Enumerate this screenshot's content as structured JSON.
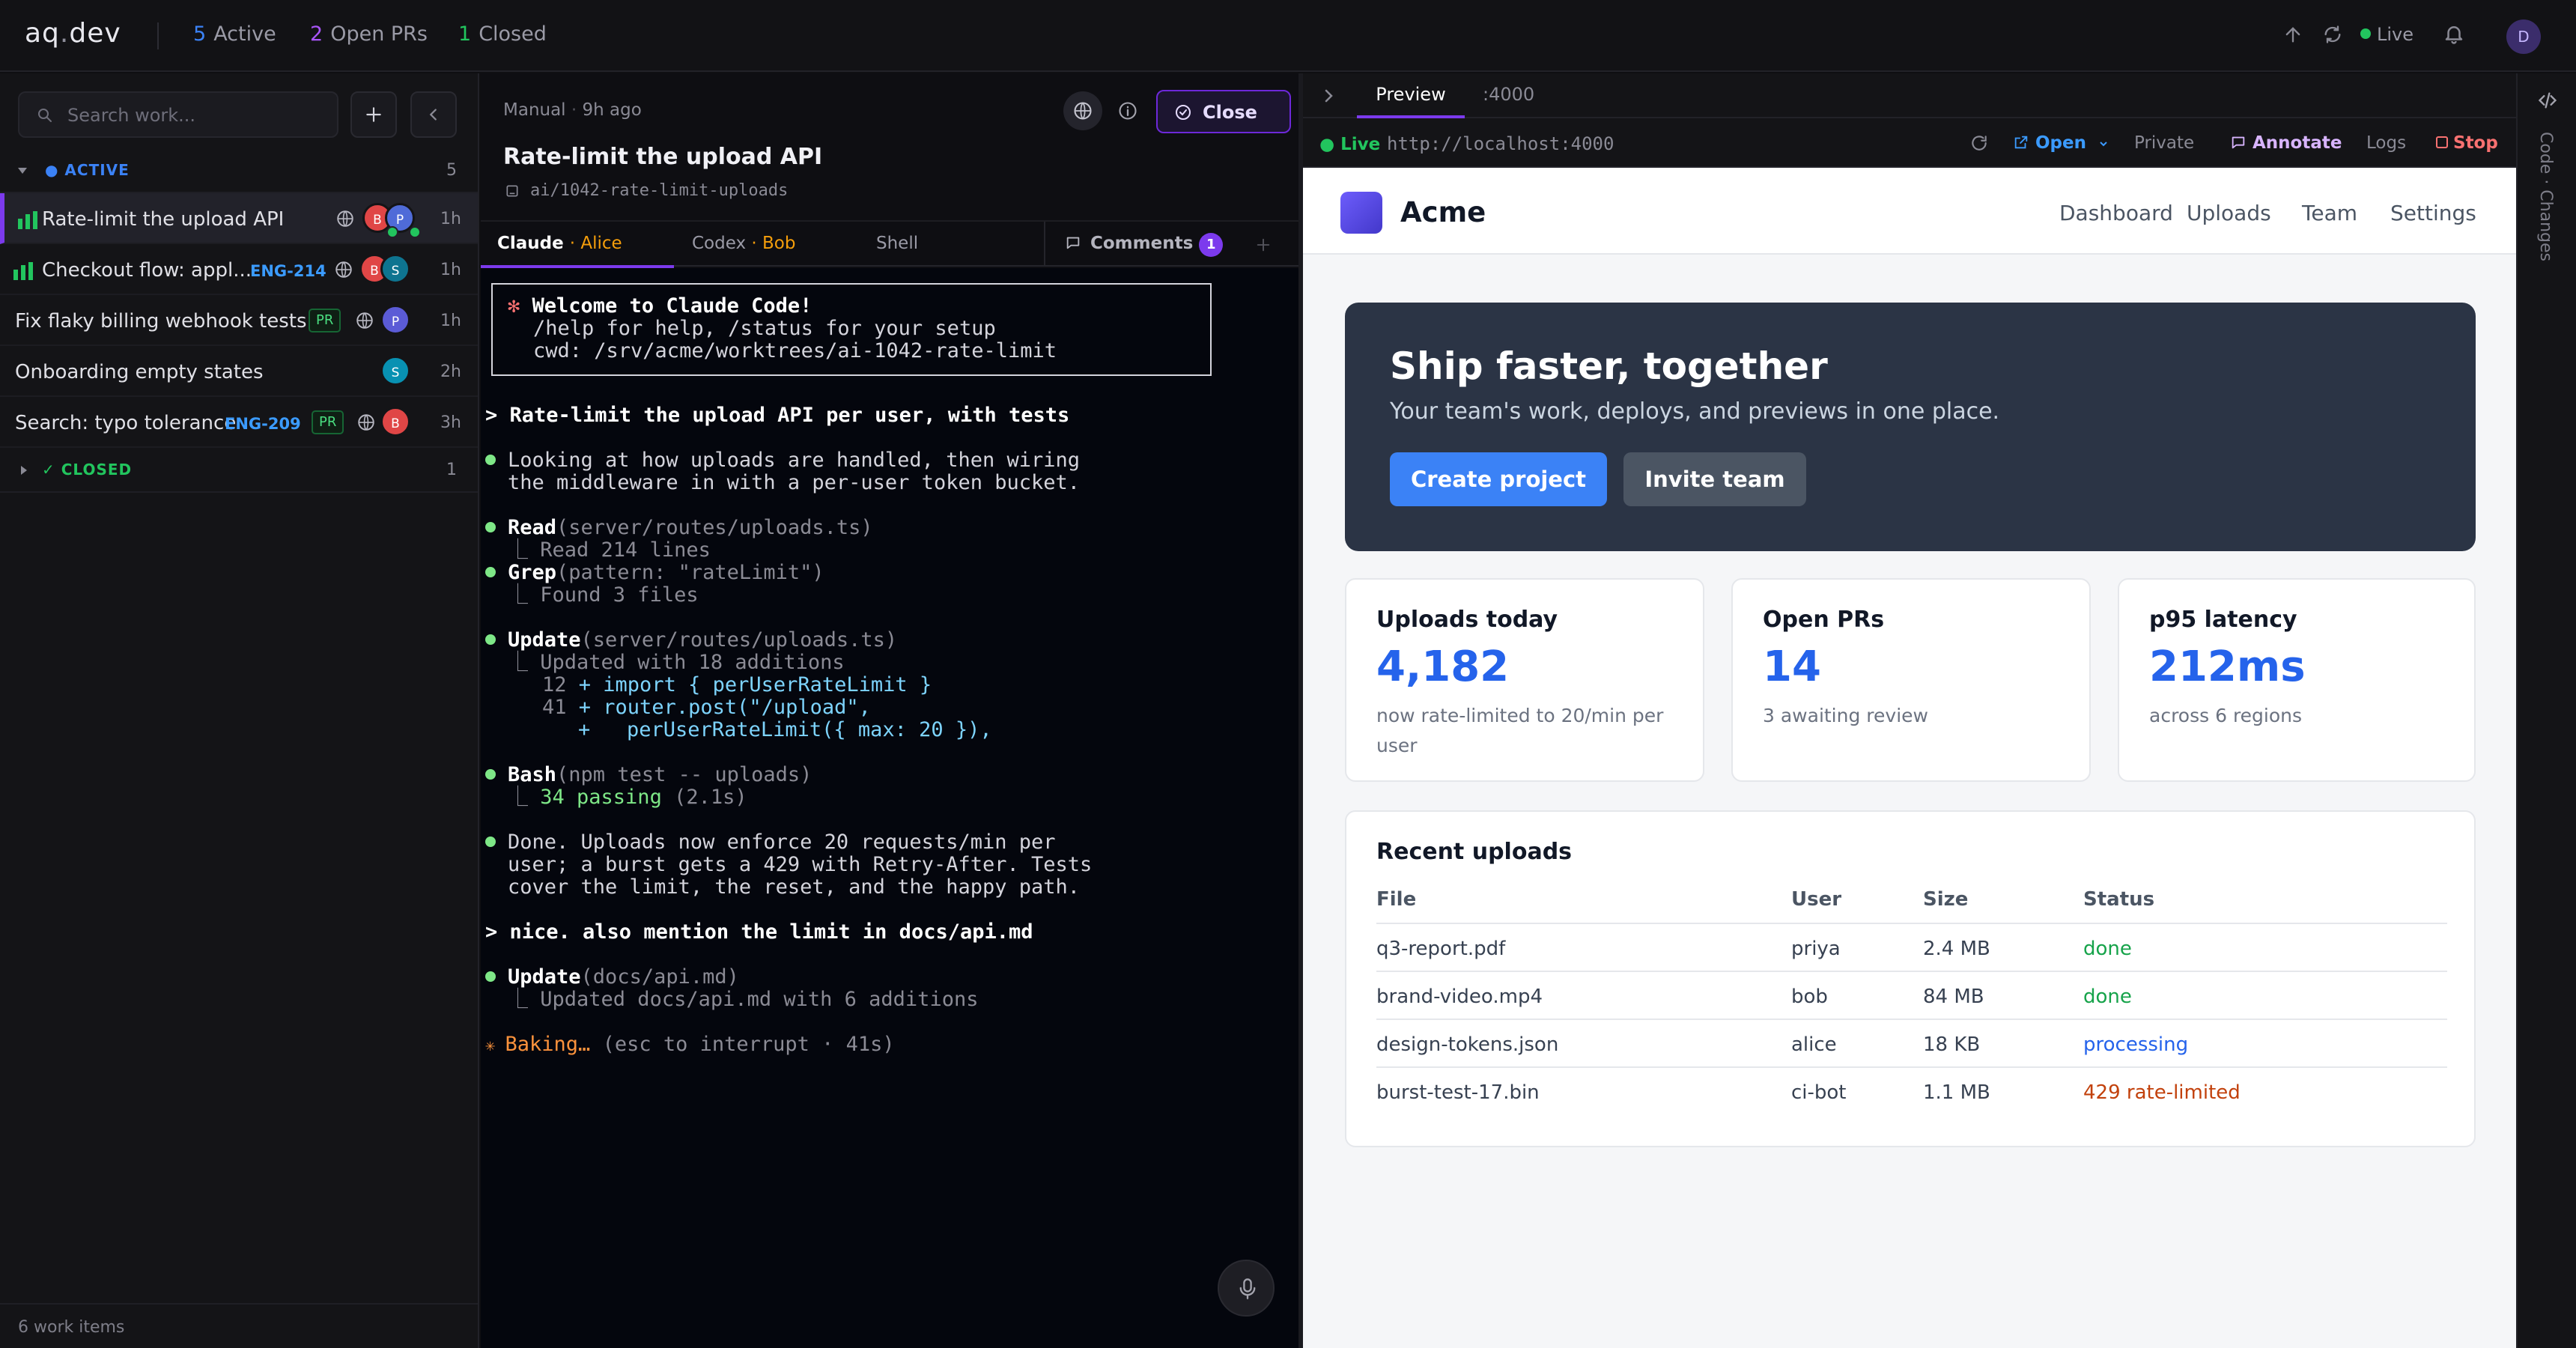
{
  "topbar": {
    "logo_main": "aq",
    "logo_dot": ".",
    "logo_tld": "dev",
    "stats": [
      {
        "count": "5",
        "label": "Active",
        "color": "#3b82f6"
      },
      {
        "count": "2",
        "label": "Open PRs",
        "color": "#a855f7"
      },
      {
        "count": "1",
        "label": "Closed",
        "color": "#22c55e"
      }
    ],
    "live_label": "Live",
    "user_initial": "D"
  },
  "sidebar": {
    "search_placeholder": "Search work...",
    "active_section": {
      "label": "ACTIVE",
      "count": "5",
      "color": "#3b82f6"
    },
    "items": [
      {
        "title": "Rate-limit the upload API",
        "age": "1h",
        "selected": true
      },
      {
        "title": "Checkout flow: appl...",
        "tag": "ENG-214",
        "age": "1h"
      },
      {
        "title": "Fix flaky billing webhook tests",
        "pr": "PR",
        "age": "1h"
      },
      {
        "title": "Onboarding empty states",
        "age": "2h"
      },
      {
        "title": "Search: typo tolerance",
        "tag": "ENG-209",
        "pr": "PR",
        "age": "3h"
      }
    ],
    "avatars": {
      "b": "B",
      "p": "P",
      "s": "S"
    },
    "closed_section": {
      "label": "CLOSED",
      "count": "1",
      "color": "#22c55e"
    },
    "footer": "6 work items"
  },
  "task": {
    "mode": "Manual",
    "time": "9h ago",
    "title": "Rate-limit the upload API",
    "branch": "ai/1042-rate-limit-uploads",
    "close_label": "Close"
  },
  "agent_tabs": [
    {
      "name": "Claude",
      "user": "Alice",
      "active": true
    },
    {
      "name": "Codex",
      "user": "Bob"
    },
    {
      "name": "Shell"
    }
  ],
  "comments": {
    "label": "Comments",
    "count": "1"
  },
  "terminal": {
    "welcome_title": "Welcome to Claude Code!",
    "welcome_help": "/help for help, /status for your setup",
    "welcome_cwd": "cwd: /srv/acme/worktrees/ai-1042-rate-limit",
    "prompt1": "> Rate-limit the upload API per user, with tests",
    "msg1a": "Looking at how uploads are handled, then wiring",
    "msg1b": "the middleware in with a per-user token bucket.",
    "read_tool": "Read",
    "read_arg": "(server/routes/uploads.ts)",
    "read_result": "Read 214 lines",
    "grep_tool": "Grep",
    "grep_arg": "(pattern: \"rateLimit\")",
    "grep_result": "Found 3 files",
    "update_tool": "Update",
    "update_arg": "(server/routes/uploads.ts)",
    "update_result": "Updated with 18 additions",
    "diff1_num": "12",
    "diff1": "+ import { perUserRateLimit }",
    "diff2_num": "41",
    "diff2": "+ router.post(\"/upload\",",
    "diff3": "+   perUserRateLimit({ max: 20 }),",
    "bash_tool": "Bash",
    "bash_arg": "(npm test -- uploads)",
    "bash_pass": "34 passing",
    "bash_time": "(2.1s)",
    "done1": "Done. Uploads now enforce 20 requests/min per",
    "done2": "user; a burst gets a 429 with Retry-After. Tests",
    "done3": "cover the limit, the reset, and the happy path.",
    "prompt2": "> nice. also mention the limit in docs/api.md",
    "update2_tool": "Update",
    "update2_arg": "(docs/api.md)",
    "update2_result": "Updated docs/api.md with 6 additions",
    "status_word": "Baking…",
    "status_rest": "(esc to interrupt · 41s)"
  },
  "preview": {
    "tab_preview": "Preview",
    "tab_port": ":4000",
    "live": "Live",
    "url": "http://localhost:4000",
    "open": "Open",
    "private": "Private",
    "annotate": "Annotate",
    "logs": "Logs",
    "stop": "Stop"
  },
  "rail": {
    "label": "Code · Changes"
  },
  "acme": {
    "brand": "Acme",
    "nav": [
      "Dashboard",
      "Uploads",
      "Team",
      "Settings"
    ],
    "hero_title": "Ship faster, together",
    "hero_sub": "Your team's work, deploys, and previews in one place.",
    "btn_create": "Create project",
    "btn_invite": "Invite team",
    "cards": [
      {
        "title": "Uploads today",
        "value": "4,182",
        "sub": "now rate-limited to 20/min per user"
      },
      {
        "title": "Open PRs",
        "value": "14",
        "sub": "3 awaiting review"
      },
      {
        "title": "p95 latency",
        "value": "212ms",
        "sub": "across 6 regions"
      }
    ],
    "recent_title": "Recent uploads",
    "columns": [
      "File",
      "User",
      "Size",
      "Status"
    ],
    "rows": [
      {
        "file": "q3-report.pdf",
        "user": "priya",
        "size": "2.4 MB",
        "status": "done",
        "color": "#16a34a"
      },
      {
        "file": "brand-video.mp4",
        "user": "bob",
        "size": "84 MB",
        "status": "done",
        "color": "#16a34a"
      },
      {
        "file": "design-tokens.json",
        "user": "alice",
        "size": "18 KB",
        "status": "processing",
        "color": "#2563eb"
      },
      {
        "file": "burst-test-17.bin",
        "user": "ci-bot",
        "size": "1.1 MB",
        "status": "429 rate-limited",
        "color": "#c2410c"
      }
    ]
  }
}
